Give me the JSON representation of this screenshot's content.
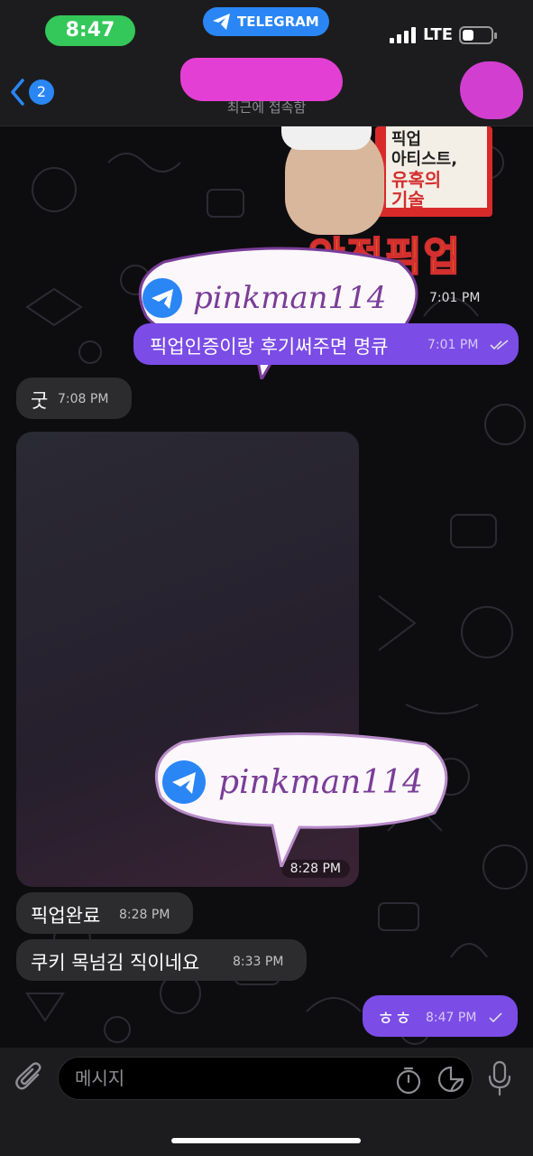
{
  "status_bar": {
    "time": "8:47",
    "app_pill": "TELEGRAM",
    "network": "LTE"
  },
  "header": {
    "back_badge": "2",
    "subtitle": "최근에 접속함"
  },
  "sticker": {
    "book_line1": "픽업",
    "book_line2": "아티스트,",
    "book_line3": "유혹의",
    "book_line4": "기술",
    "title": "안전픽업",
    "time": "7:01 PM"
  },
  "messages": [
    {
      "id": "msg1",
      "text": "픽업인증이랑 후기써주면 명큐",
      "time": "7:01 PM",
      "direction": "out"
    },
    {
      "id": "msg2",
      "text": "굿",
      "time": "7:08 PM",
      "direction": "in"
    },
    {
      "id": "msg3",
      "text": "",
      "time": "8:28 PM",
      "direction": "in"
    },
    {
      "id": "msg4",
      "text": "픽업완료",
      "time": "8:28 PM",
      "direction": "in"
    },
    {
      "id": "msg5",
      "text": "쿠키 목넘김 직이네요",
      "time": "8:33 PM",
      "direction": "in"
    },
    {
      "id": "msg6",
      "text": "ㅎㅎ",
      "time": "8:47 PM",
      "direction": "out"
    }
  ],
  "watermarks": [
    "pinkman114",
    "pinkman114"
  ],
  "input": {
    "placeholder": "메시지"
  },
  "colors": {
    "outgoing": "#7b4ce6",
    "incoming": "#2c2c2e",
    "accent": "#2a86f5",
    "time_pill": "#34c759",
    "redaction": "#e43fd4"
  },
  "icons": [
    "telegram-icon",
    "back-chevron-icon",
    "read-checks-icon",
    "paperclip-icon",
    "timer-icon",
    "sticker-icon",
    "microphone-icon"
  ]
}
